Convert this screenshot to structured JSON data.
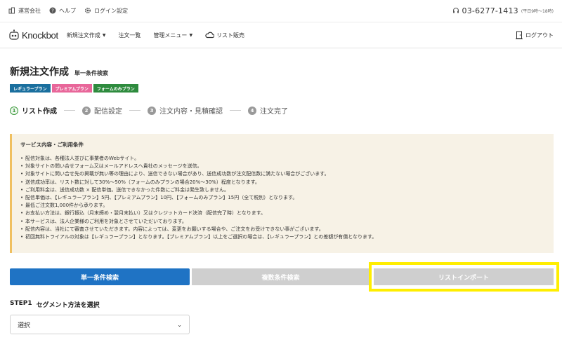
{
  "utility_bar": {
    "company_label": "運営会社",
    "help_label": "ヘルプ",
    "login_settings_label": "ログイン設定",
    "phone": "03-6277-1413",
    "hours": "(平日9時〜18時)"
  },
  "navbar": {
    "logo_text": "Knockbot",
    "items": [
      {
        "label": "新規注文作成",
        "has_caret": true
      },
      {
        "label": "注文一覧",
        "has_caret": false
      },
      {
        "label": "管理メニュー",
        "has_caret": true
      },
      {
        "label": "リスト販売",
        "has_caret": false
      }
    ],
    "logout_label": "ログアウト"
  },
  "page": {
    "title": "新規注文作成",
    "subtitle": "単一条件検索"
  },
  "badges": [
    {
      "label": "レギュラープラン",
      "color": "#1a6f9e"
    },
    {
      "label": "プレミアムプラン",
      "color": "#e8679a"
    },
    {
      "label": "フォームのみプラン",
      "color": "#2e8b3e"
    }
  ],
  "steps": [
    {
      "num": "1",
      "label": "リスト作成",
      "active": true
    },
    {
      "num": "2",
      "label": "配信設定",
      "active": false
    },
    {
      "num": "3",
      "label": "注文内容・見積確認",
      "active": false
    },
    {
      "num": "4",
      "label": "注文完了",
      "active": false
    }
  ],
  "notice": {
    "title": "サービス内容・ご利用条件",
    "items": [
      "配信対象は、各種法人並びに事業者のWebサイト。",
      "対象サイトの問い合せフォーム又はメールアドレスへ貴社のメッセージを送信。",
      "対象サイトに問い合せ先の掲載が無い等の理由により、送信できない場合があり、送信成功数が注文配信数に満たない場合がございます。",
      "送信成功率は、リスト数に対して30%〜50%（フォームのみプランの場合20%〜30%）程度となります。",
      "ご利用料金は、送信成功数 × 配信単価。送信できなかった件数にご料金は発生致しません。",
      "配信単価は、【レギュラープラン】5円、【プレミアムプラン】10円、【フォームのみプラン】15円（全て税別）となります。",
      "最低ご注文数1,000件から承ります。",
      "お支払い方法は、銀行振込（月末締め・翌月末払い）又はクレジットカード決済（配信完了時）となります。",
      "本サービスは、法人企業様のご利用を対象とさせていただいております。",
      "配信内容は、当社にて審査させていただきます。内容によっては、変更をお願いする場合や、ご注文をお受けできない事がございます。",
      "初回無料トライアルの対象は【レギュラープラン】となります。【プレミアムプラン】以上をご選択の場合は、【レギュラープラン】との差額が有償となります。"
    ]
  },
  "search_tabs": {
    "single": "単一条件検索",
    "multi": "複数条件検索",
    "import": "リストインポート"
  },
  "step1": {
    "label": "STEP1",
    "text": "セグメント方法を選択",
    "select_value": "選択"
  },
  "colors": {
    "primary": "#1f73c4",
    "highlight": "#ffee00",
    "notice_bg": "#f7f2e6"
  }
}
